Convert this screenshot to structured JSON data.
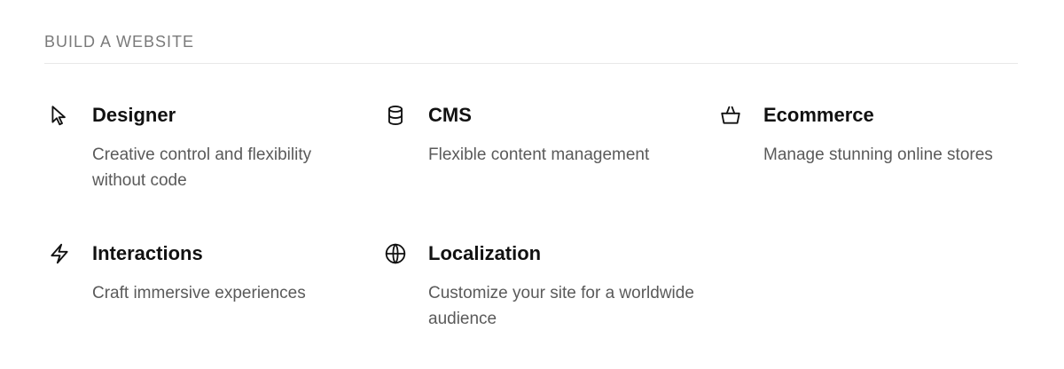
{
  "section": {
    "heading": "BUILD A WEBSITE"
  },
  "items": [
    {
      "icon": "cursor-arrow-icon",
      "title": "Designer",
      "description": "Creative control and flexibility without code"
    },
    {
      "icon": "database-icon",
      "title": "CMS",
      "description": "Flexible content management"
    },
    {
      "icon": "shopping-basket-icon",
      "title": "Ecommerce",
      "description": "Manage stunning online stores"
    },
    {
      "icon": "lightning-bolt-icon",
      "title": "Interactions",
      "description": "Craft immersive experiences"
    },
    {
      "icon": "globe-icon",
      "title": "Localization",
      "description": "Customize your site for a worldwide audience"
    }
  ],
  "colors": {
    "heading": "#7a7a7a",
    "title": "#111111",
    "description": "#5a5a5a",
    "divider": "#e8e8e8",
    "background": "#ffffff"
  }
}
